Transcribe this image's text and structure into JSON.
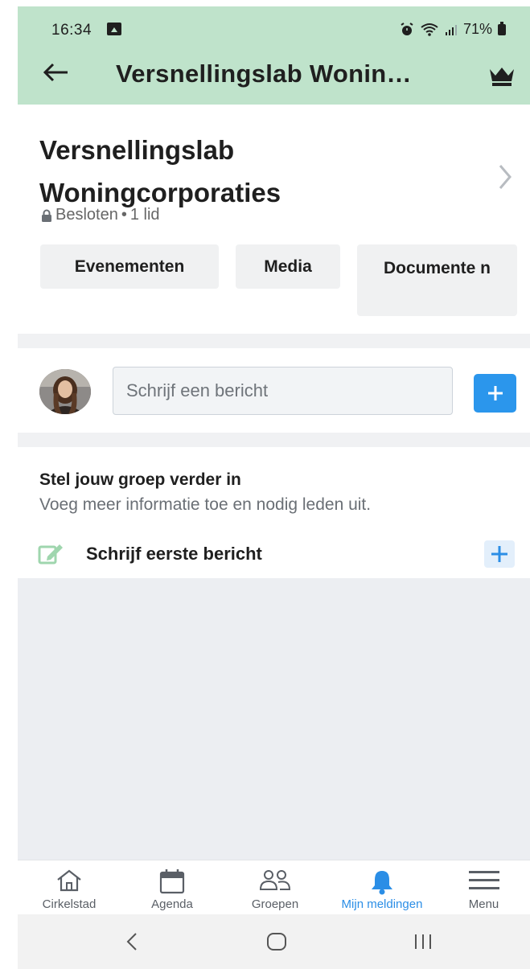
{
  "status_bar": {
    "time": "16:34",
    "battery": "71%",
    "icons": [
      "image-icon",
      "alarm-icon",
      "wifi-icon",
      "signal-icon",
      "battery-icon"
    ]
  },
  "header": {
    "title": "Versnellingslab Wonin…",
    "back_icon": "arrow-left-icon",
    "crown_icon": "crown-icon",
    "background": "#bfe3cb"
  },
  "group": {
    "name": "Versnellingslab Woningcorporaties",
    "visibility": "Besloten",
    "separator": "•",
    "members": "1 lid"
  },
  "chips": {
    "events": "Evenementen",
    "media": "Media",
    "documents": "Documente n"
  },
  "compose": {
    "placeholder": "Schrijf een bericht"
  },
  "setup": {
    "title": "Stel jouw groep verder in",
    "subtitle": "Voeg meer informatie toe en nodig leden uit.",
    "first_post": "Schrijf eerste bericht"
  },
  "bottom_nav": {
    "items": [
      {
        "label": "Cirkelstad",
        "icon": "home-icon"
      },
      {
        "label": "Agenda",
        "icon": "calendar-icon"
      },
      {
        "label": "Groepen",
        "icon": "groups-icon"
      },
      {
        "label": "Mijn meldingen",
        "icon": "bell-icon"
      },
      {
        "label": "Menu",
        "icon": "hamburger-icon"
      }
    ],
    "active_index": 3,
    "accent": "#2b8ee6"
  }
}
